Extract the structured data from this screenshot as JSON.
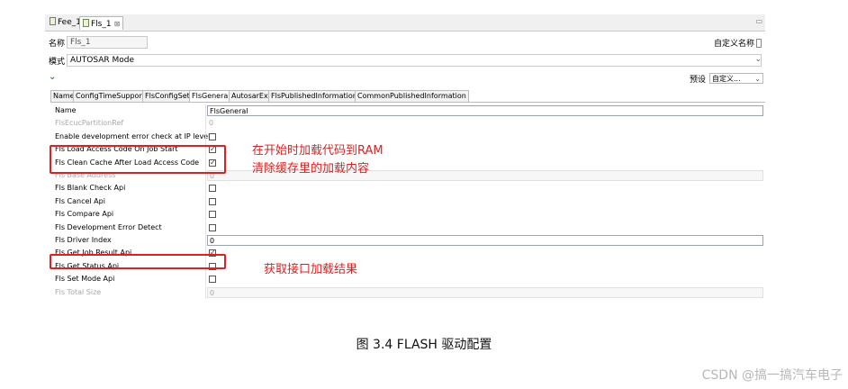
{
  "tabs": [
    {
      "label": "Fee_1",
      "active": false
    },
    {
      "label": "Fls_1",
      "active": true,
      "close": "⊠"
    }
  ],
  "window_controls": "▭",
  "name_row": {
    "label": "名称",
    "value": "Fls_1",
    "right_label": "自定义名称"
  },
  "mode_row": {
    "label": "模式",
    "value": "AUTOSAR Mode"
  },
  "preset_row": {
    "label": "预设",
    "value": "自定义..."
  },
  "config_tabs": [
    {
      "label": "Name",
      "active": false
    },
    {
      "label": "ConfigTimeSupport",
      "active": false
    },
    {
      "label": "FlsConfigSet",
      "active": false
    },
    {
      "label": "FlsGeneral",
      "active": true
    },
    {
      "label": "AutosarExt",
      "active": false
    },
    {
      "label": "FlsPublishedInformation",
      "active": false
    },
    {
      "label": "CommonPublishedInformation",
      "active": false
    }
  ],
  "params": [
    {
      "name": "Name",
      "type": "text",
      "value": "FlsGeneral",
      "disabled": false
    },
    {
      "name": "FlsEcucPartitionRef",
      "type": "plain",
      "value": "0",
      "disabled": true
    },
    {
      "name": "Enable development error check at IP level",
      "type": "checkbox",
      "checked": false,
      "disabled": false
    },
    {
      "name": "Fls Load Access Code On Job Start",
      "type": "checkbox",
      "checked": true,
      "disabled": false
    },
    {
      "name": "Fls Clean Cache After Load Access Code",
      "type": "checkbox",
      "checked": true,
      "disabled": false
    },
    {
      "name": "Fls Base Address",
      "type": "disabledbox",
      "value": "0",
      "disabled": true
    },
    {
      "name": "Fls Blank Check Api",
      "type": "checkbox",
      "checked": false,
      "disabled": false
    },
    {
      "name": "Fls Cancel Api",
      "type": "checkbox",
      "checked": false,
      "disabled": false
    },
    {
      "name": "Fls Compare Api",
      "type": "checkbox",
      "checked": false,
      "disabled": false
    },
    {
      "name": "Fls Development Error Detect",
      "type": "checkbox",
      "checked": false,
      "disabled": false
    },
    {
      "name": "Fls Driver Index",
      "type": "text",
      "value": "0",
      "disabled": false
    },
    {
      "name": "Fls Get Job Result Api",
      "type": "checkbox",
      "checked": true,
      "disabled": false
    },
    {
      "name": "Fls Get Status Api",
      "type": "checkbox",
      "checked": false,
      "disabled": false
    },
    {
      "name": "Fls Set Mode Api",
      "type": "checkbox",
      "checked": false,
      "disabled": false
    },
    {
      "name": "Fls Total Size",
      "type": "disabledbox",
      "value": "0",
      "disabled": true
    }
  ],
  "annotations": {
    "note1": "在开始时加载代码到RAM",
    "note2": "清除缓存里的加载内容",
    "note3": "获取接口加载结果",
    "color": "#e02020"
  },
  "caption": "图  3.4 FLASH 驱动配置",
  "watermark": "CSDN @搞一搞汽车电子"
}
